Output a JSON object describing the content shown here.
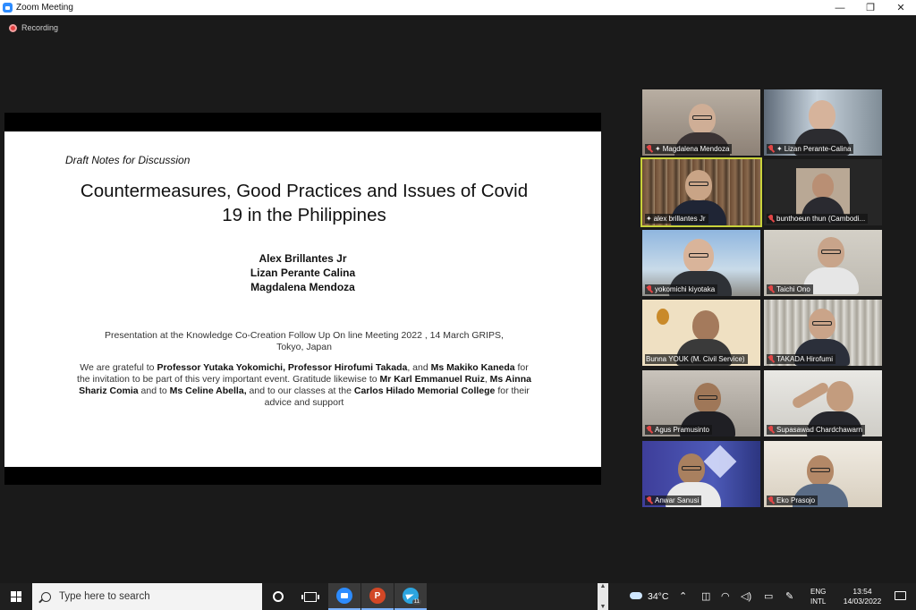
{
  "window": {
    "title": "Zoom Meeting",
    "minimize": "—",
    "restore": "❐",
    "close": "✕"
  },
  "recording": {
    "label": "Recording"
  },
  "slide": {
    "kicker": "Draft Notes for Discussion",
    "title_line1": "Countermeasures, Good Practices and Issues of Covid",
    "title_line2": "19 in the Philippines",
    "authors": [
      "Alex Brillantes Jr",
      "Lizan Perante Calina",
      "Magdalena Mendoza"
    ],
    "presented_line1": "Presentation at the Knowledge Co-Creation  Follow Up On line Meeting 2022 , 14 March GRIPS,",
    "presented_line2": "Tokyo, Japan",
    "thanks": {
      "t1": "We are grateful to ",
      "b1": "Professor Yutaka Yokomichi, Professor Hirofumi Takada",
      "t2": ", and ",
      "b2": "Ms Makiko Kaneda",
      "t3": " for the invitation to be part of this very important event. Gratitude likewise to ",
      "b3": "Mr Karl Emmanuel Ruiz",
      "t4": ", ",
      "b4": "Ms Ainna Shariz Comia",
      "t5": " and to ",
      "b5": "Ms Celine Abella,",
      "t6": " and to our classes at the ",
      "b6": "Carlos Hilado Memorial College",
      "t7": " for their advice and support"
    }
  },
  "participants": [
    {
      "name": "Magdalena Mendoza",
      "pinned": true
    },
    {
      "name": "Lizan Perante-Calina",
      "pinned": true
    },
    {
      "name": "alex brillantes Jr",
      "pinned": true
    },
    {
      "name": "bunthoeun thun (Cambodi...",
      "pinned": false
    },
    {
      "name": "yokomichi kiyotaka",
      "pinned": false
    },
    {
      "name": "Taichi Ono",
      "pinned": false
    },
    {
      "name": "Bunna YOUK (M. Civil Service)",
      "pinned": false
    },
    {
      "name": "TAKADA Hirofumi",
      "pinned": false
    },
    {
      "name": "Agus Pramusinto",
      "pinned": false
    },
    {
      "name": "Supasawad Chardchawarn",
      "pinned": false
    },
    {
      "name": "Anwar Sanusi",
      "pinned": false
    },
    {
      "name": "Eko Prasojo",
      "pinned": false
    }
  ],
  "taskbar": {
    "search_placeholder": "Type here to search",
    "powerpoint_letter": "P",
    "telegram_badge": "11",
    "weather_temp": "34°C",
    "lang_line1": "ENG",
    "lang_line2": "INTL",
    "time": "13:54",
    "date": "14/03/2022"
  }
}
